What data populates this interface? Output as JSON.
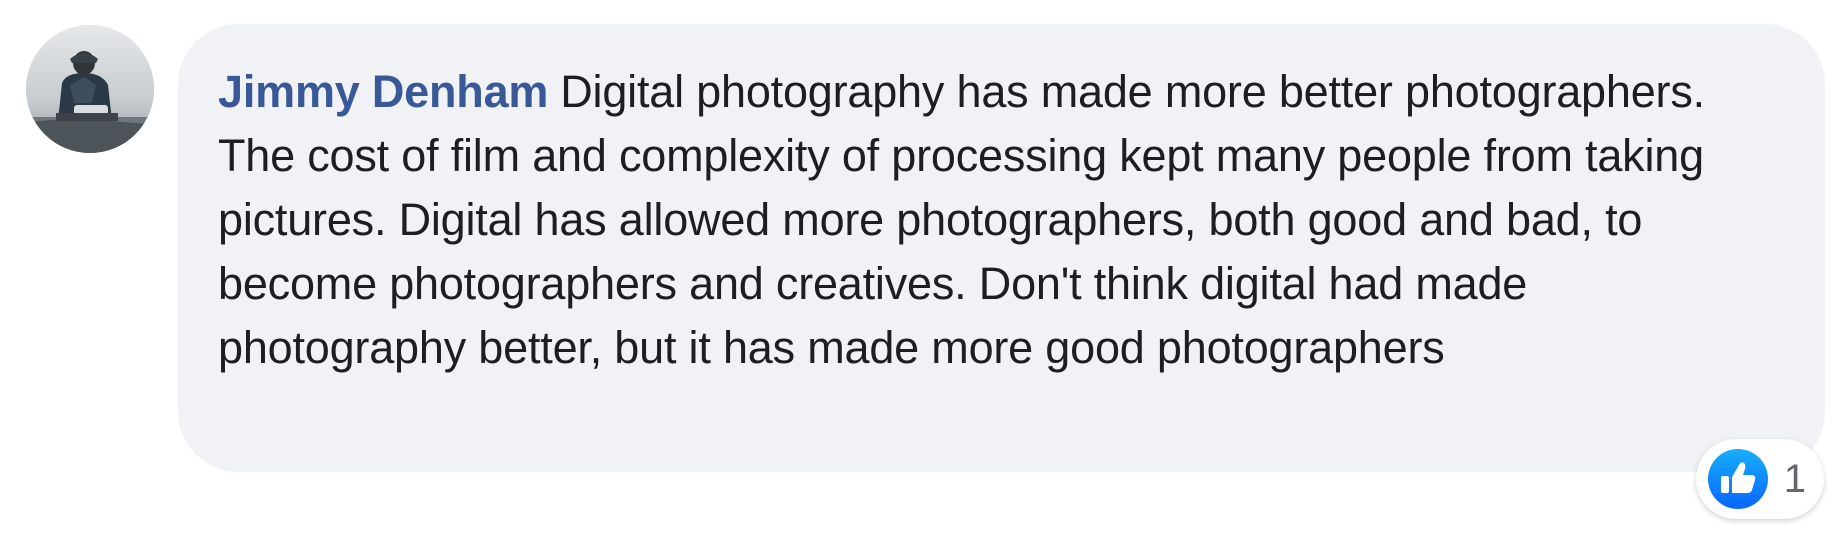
{
  "comment": {
    "author": "Jimmy Denham",
    "text": "Digital photography has made more better photographers. The cost of film and complexity of processing kept many people from taking pictures. Digital has allowed more photographers, both good and bad, to become photographers and creatives. Don't think digital had made photography better, but it has made more good photographers",
    "avatar_icon": "user-photo-avatar",
    "reactions": {
      "icon": "like-icon",
      "count": "1"
    }
  },
  "colors": {
    "author_link": "#385898",
    "bubble_bg": "#f0f2f5",
    "text": "#1c1e21",
    "like_blue": "#1877f2",
    "count": "#65676b"
  }
}
